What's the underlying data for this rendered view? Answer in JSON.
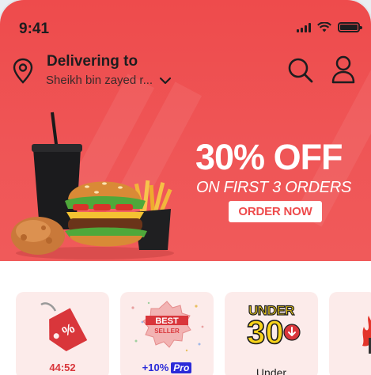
{
  "status_bar": {
    "time": "9:41"
  },
  "header": {
    "delivering_label": "Delivering to",
    "address": "Sheikh bin zayed r..."
  },
  "promo": {
    "headline": "30% OFF",
    "subline": "ON FIRST 3 ORDERS",
    "cta_label": "ORDER NOW"
  },
  "categories": [
    {
      "label": "44:52",
      "icon": "discount-tag-icon"
    },
    {
      "badge_top": "BEST",
      "badge_bottom": "SELLER",
      "label": "+10%",
      "tag": "Pro",
      "icon": "best-seller-badge-icon"
    },
    {
      "badge_top": "UNDER",
      "badge_number": "30",
      "label": "Under",
      "icon": "under-30-icon"
    },
    {
      "label": "",
      "icon": "fire-icon"
    }
  ],
  "colors": {
    "brand_red": "#ee4b4c",
    "card_bg": "#fcebea",
    "pro_blue": "#2b2bd9",
    "under_yellow": "#f7d31b"
  }
}
